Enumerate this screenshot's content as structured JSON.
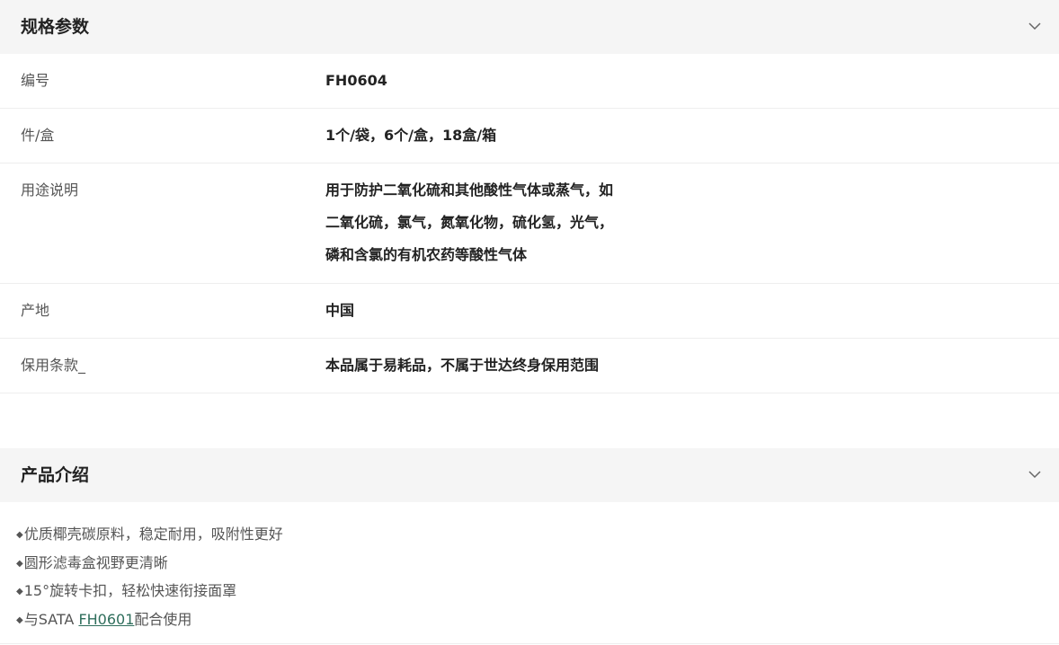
{
  "specs_section": {
    "title": "规格参数",
    "rows": [
      {
        "label": "编号",
        "value": "FH0604"
      },
      {
        "label": "件/盒",
        "value": "1个/袋，6个/盒，18盒/箱"
      },
      {
        "label": "用途说明",
        "value_lines": [
          "用于防护二氧化硫和其他酸性气体或蒸气，如",
          "二氧化硫，氯气，氮氧化物，硫化氢，光气，",
          "磷和含氯的有机农药等酸性气体"
        ]
      },
      {
        "label": "产地",
        "value": "中国"
      },
      {
        "label": "保用条款_",
        "value": "本品属于易耗品，不属于世达终身保用范围"
      }
    ]
  },
  "intro_section": {
    "title": "产品介绍",
    "bullet": "◆",
    "items": [
      "优质椰壳碳原料，稳定耐用，吸附性更好",
      "圆形滤毒盒视野更清晰",
      "15°旋转卡扣，轻松快速衔接面罩"
    ],
    "last_item": {
      "prefix": "与SATA ",
      "link": "FH0601",
      "suffix": "配合使用"
    }
  },
  "icons": {
    "collapse": "chevron-down-icon"
  },
  "colors": {
    "header_bg": "#f5f5f5",
    "link": "#2f6e5c",
    "divider": "#eeeeee"
  }
}
